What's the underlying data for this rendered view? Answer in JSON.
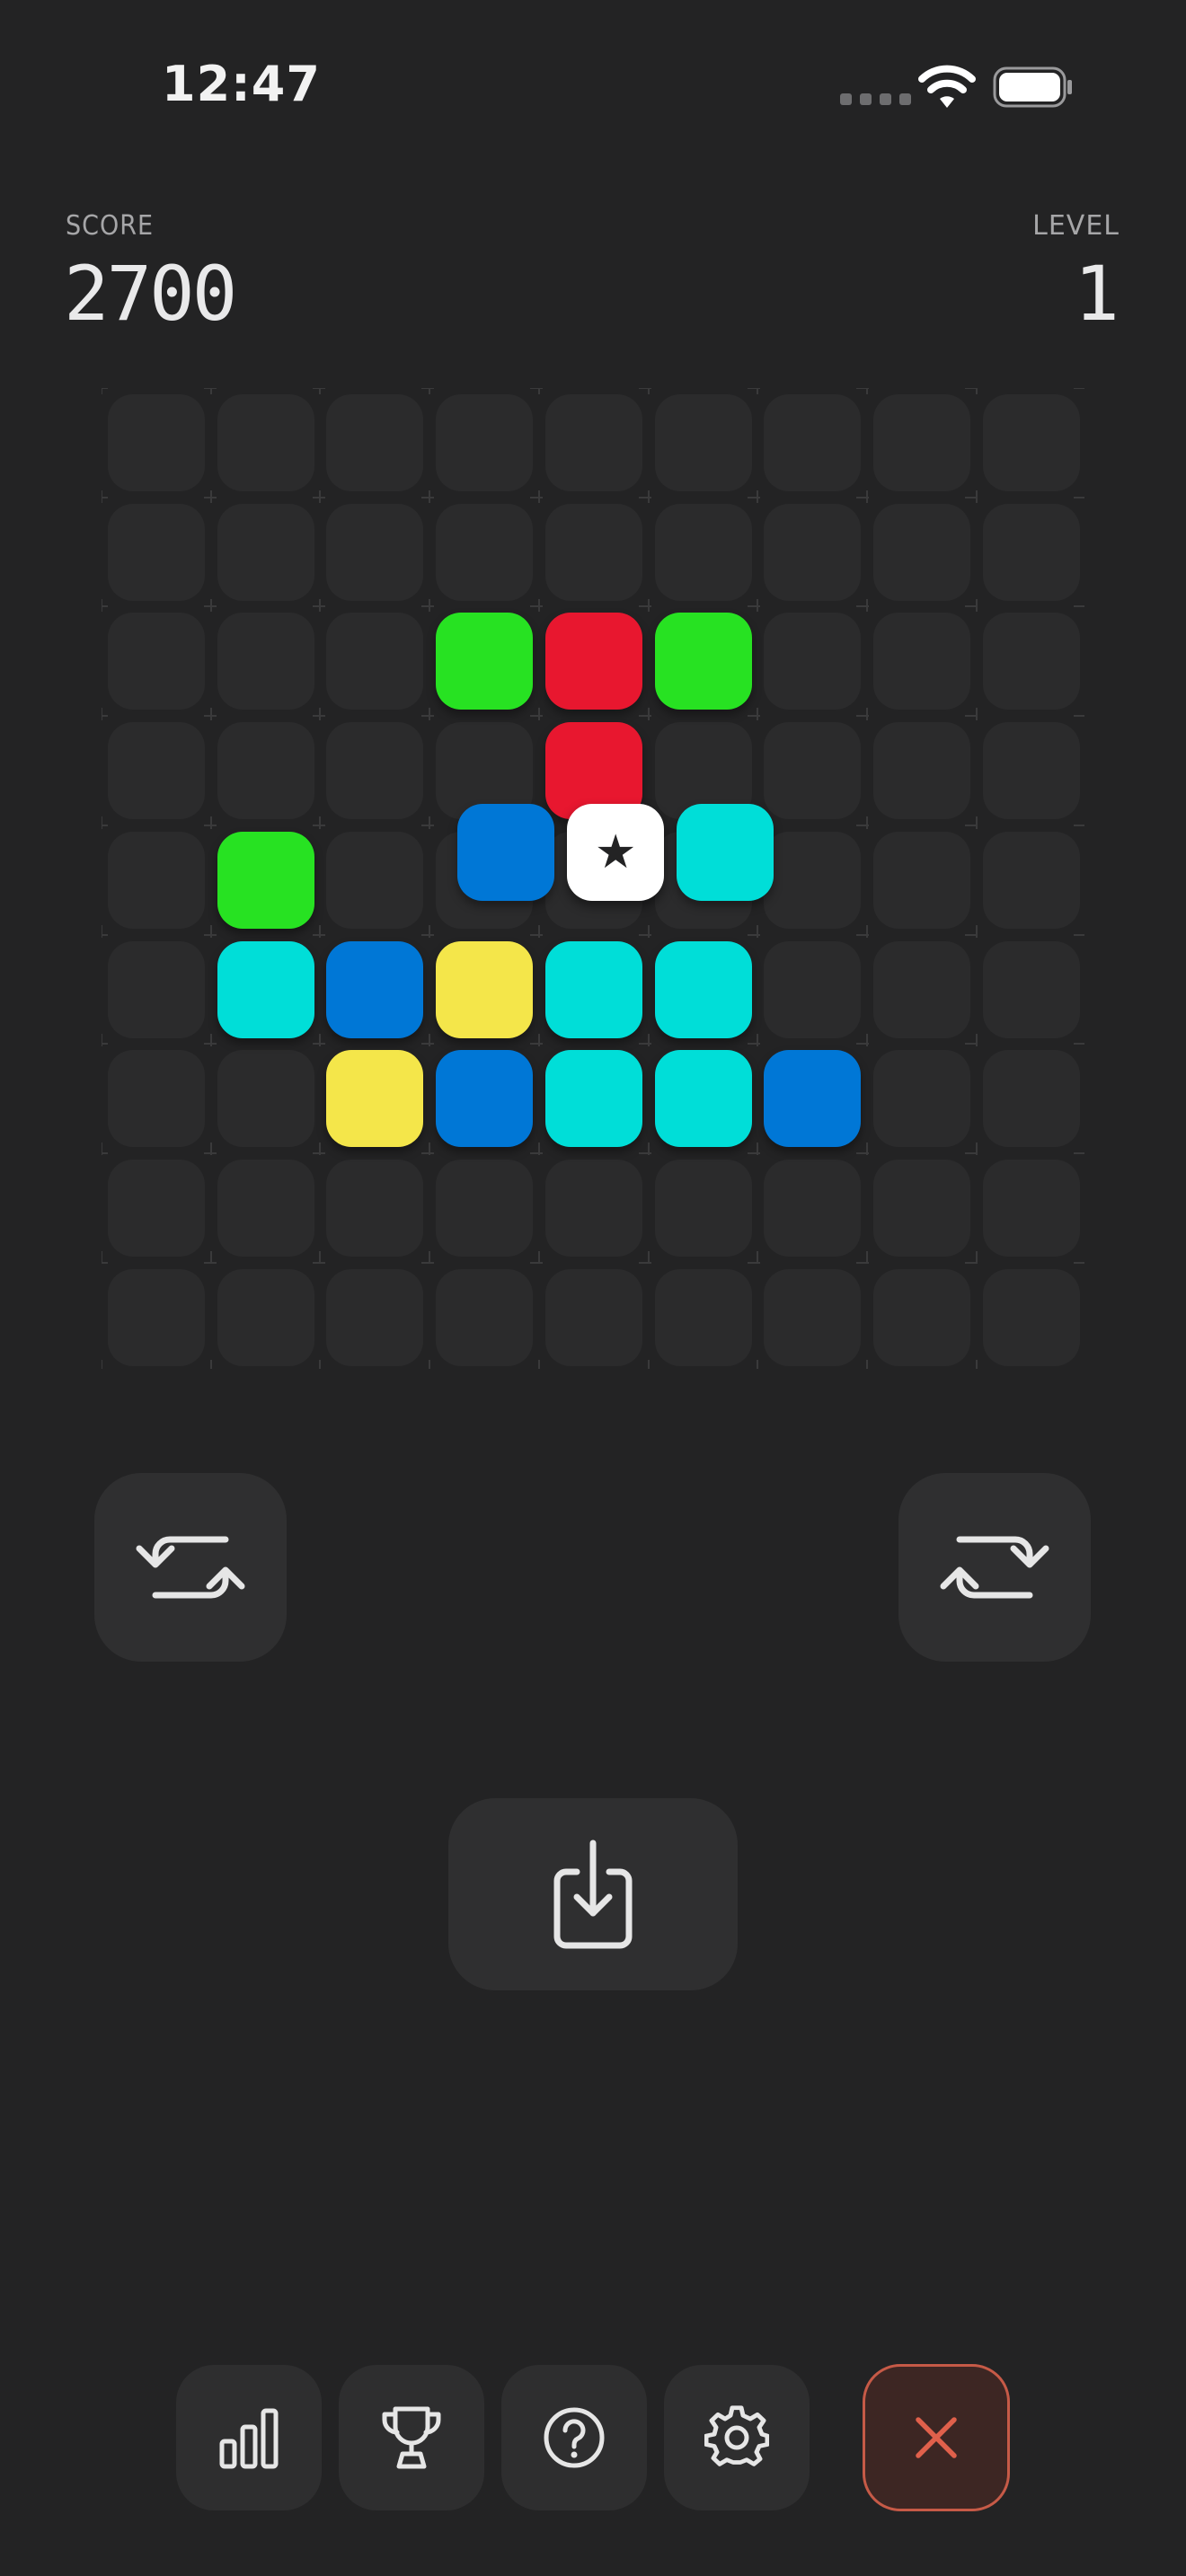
{
  "status_bar": {
    "time": "12:47",
    "icons": [
      "signal-icon",
      "wifi-icon",
      "battery-icon"
    ]
  },
  "hud": {
    "score_label": "SCORE",
    "score_value": "2700",
    "level_label": "LEVEL",
    "level_value": "1"
  },
  "board": {
    "rows": 9,
    "cols": 9,
    "empty_cell_color": "#2b2b2c",
    "grid_line_color": "#3a3a3b",
    "colors": {
      "green": "#27e222",
      "red": "#e8172f",
      "blue": "#0077d6",
      "cyan": "#00ded8",
      "yellow": "#f4e64a"
    },
    "tiles": [
      {
        "row": 2,
        "col": 3,
        "color": "green"
      },
      {
        "row": 2,
        "col": 4,
        "color": "red"
      },
      {
        "row": 2,
        "col": 5,
        "color": "green"
      },
      {
        "row": 3,
        "col": 4,
        "color": "red"
      },
      {
        "row": 4,
        "col": 1,
        "color": "green"
      },
      {
        "row": 5,
        "col": 1,
        "color": "cyan"
      },
      {
        "row": 5,
        "col": 2,
        "color": "blue"
      },
      {
        "row": 5,
        "col": 3,
        "color": "yellow"
      },
      {
        "row": 5,
        "col": 4,
        "color": "cyan"
      },
      {
        "row": 5,
        "col": 5,
        "color": "cyan"
      },
      {
        "row": 6,
        "col": 2,
        "color": "yellow"
      },
      {
        "row": 6,
        "col": 3,
        "color": "blue"
      },
      {
        "row": 6,
        "col": 4,
        "color": "cyan"
      },
      {
        "row": 6,
        "col": 5,
        "color": "cyan"
      },
      {
        "row": 6,
        "col": 6,
        "color": "blue"
      }
    ],
    "falling_piece": {
      "cells": [
        {
          "row": 3.75,
          "col": 3.2,
          "color": "blue"
        },
        {
          "row": 3.75,
          "col": 4.2,
          "color": "star"
        },
        {
          "row": 3.75,
          "col": 5.2,
          "color": "cyan"
        }
      ],
      "star_glyph": "★"
    }
  },
  "controls": {
    "rotate_left": "rotate-counterclockwise-icon",
    "rotate_right": "rotate-clockwise-icon",
    "drop": "drop-down-icon"
  },
  "toolbar": {
    "items": [
      "stats-icon",
      "trophy-icon",
      "help-icon",
      "settings-icon",
      "close-icon"
    ],
    "close_color": "#c65a47"
  }
}
